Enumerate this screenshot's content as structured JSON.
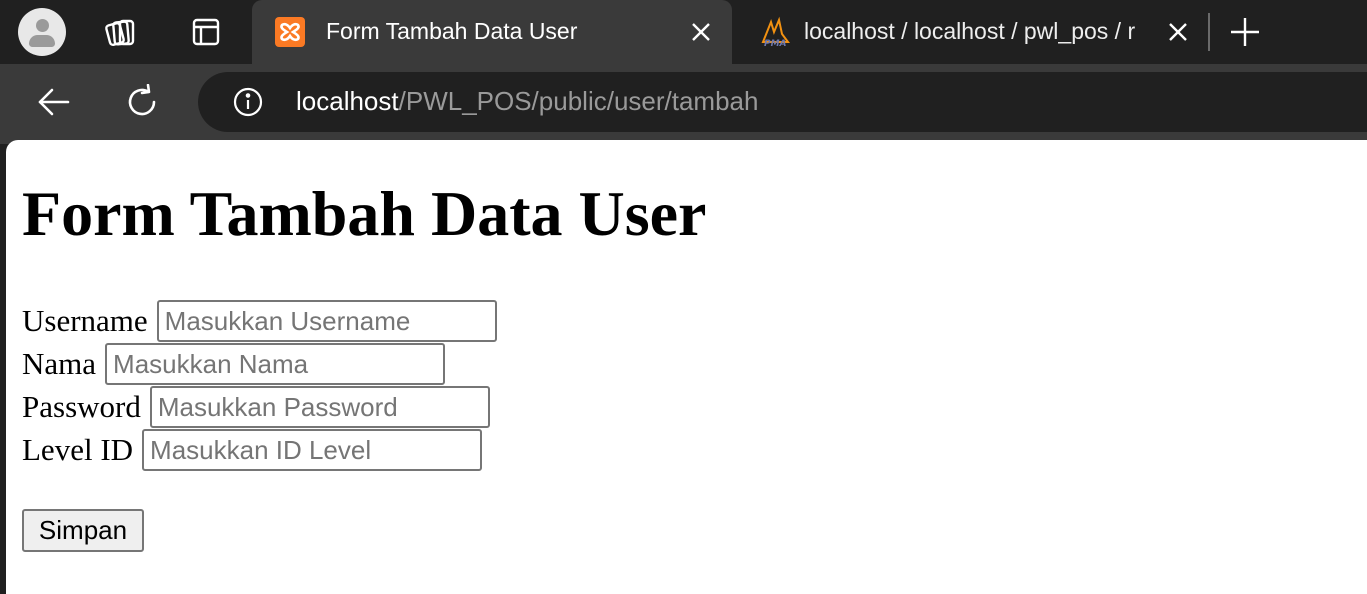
{
  "browser": {
    "tabs": [
      {
        "title": "Form Tambah Data User",
        "favicon": "xampp-icon",
        "active": true
      },
      {
        "title": "localhost / localhost / pwl_pos / r",
        "favicon": "phpmyadmin-icon",
        "active": false
      }
    ],
    "address": {
      "host": "localhost",
      "path": "/PWL_POS/public/user/tambah"
    },
    "colors": {
      "frame": "#202020",
      "toolbar": "#3a3a3a",
      "xampp_orange": "#fb7a24"
    }
  },
  "page": {
    "title": "Form Tambah Data User",
    "form": {
      "username": {
        "label": "Username",
        "placeholder": "Masukkan Username",
        "value": ""
      },
      "nama": {
        "label": "Nama",
        "placeholder": "Masukkan Nama",
        "value": ""
      },
      "password": {
        "label": "Password",
        "placeholder": "Masukkan Password",
        "value": ""
      },
      "level_id": {
        "label": "Level ID",
        "placeholder": "Masukkan ID Level",
        "value": ""
      },
      "submit_label": "Simpan"
    }
  }
}
